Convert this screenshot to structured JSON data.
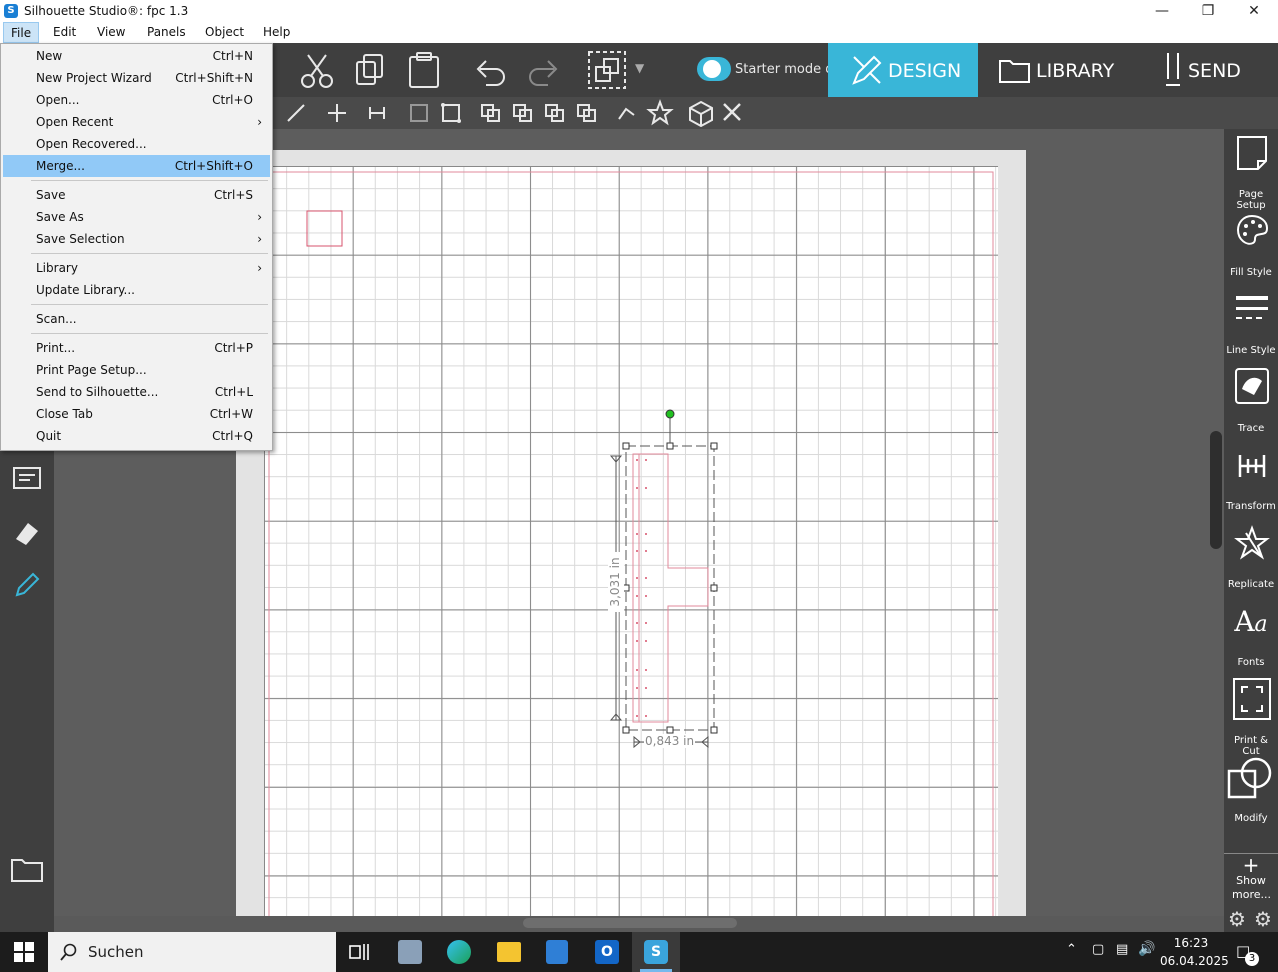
{
  "window": {
    "title": "Silhouette Studio®: fpc 1.3",
    "app_icon": "S"
  },
  "menubar": {
    "items": [
      "File",
      "Edit",
      "View",
      "Panels",
      "Object",
      "Help"
    ]
  },
  "file_menu": {
    "items": [
      {
        "label": "New",
        "shortcut": "Ctrl+N"
      },
      {
        "label": "New Project Wizard",
        "shortcut": "Ctrl+Shift+N"
      },
      {
        "label": "Open...",
        "shortcut": "Ctrl+O"
      },
      {
        "label": "Open Recent",
        "submenu": "›"
      },
      {
        "label": "Open Recovered...",
        "shortcut": ""
      },
      {
        "label": "Merge...",
        "shortcut": "Ctrl+Shift+O"
      },
      {
        "label": "Save",
        "shortcut": "Ctrl+S"
      },
      {
        "label": "Save As",
        "submenu": "›"
      },
      {
        "label": "Save Selection",
        "submenu": "›"
      },
      {
        "label": "Library",
        "submenu": "›"
      },
      {
        "label": "Update Library...",
        "shortcut": ""
      },
      {
        "label": "Scan...",
        "shortcut": ""
      },
      {
        "label": "Print...",
        "shortcut": "Ctrl+P"
      },
      {
        "label": "Print Page Setup...",
        "shortcut": ""
      },
      {
        "label": "Send to Silhouette...",
        "shortcut": "Ctrl+L"
      },
      {
        "label": "Close Tab",
        "shortcut": "Ctrl+W"
      },
      {
        "label": "Quit",
        "shortcut": "Ctrl+Q"
      }
    ],
    "highlighted": "Merge..."
  },
  "toolbar": {
    "starter_mode_label": "Starter mode on",
    "tabs": {
      "design": "DESIGN",
      "library": "LIBRARY",
      "send": "SEND"
    },
    "accent_color": "#39b6d8"
  },
  "right_panel": {
    "items": [
      "Page Setup",
      "Fill Style",
      "Line Style",
      "Trace",
      "Transform",
      "Replicate",
      "Fonts",
      "Print & Cut",
      "Modify"
    ],
    "show_more": "Show more..."
  },
  "canvas": {
    "height_label": "3,031 in",
    "width_label": "0,843 in"
  },
  "taskbar": {
    "search_placeholder": "Suchen",
    "time": "16:23",
    "date": "06.04.2025",
    "notification_count": "3"
  }
}
